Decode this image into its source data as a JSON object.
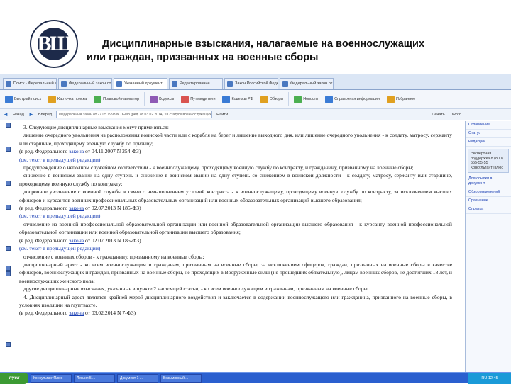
{
  "slide": {
    "title_line1": "Дисциплинарные взыскания, налагаемые на военнослужащих",
    "title_line2": "или граждан, призванных на военные сборы",
    "logo_letters": "ВШ"
  },
  "browser": {
    "tabs": [
      "Поиск - Федеральный закон от 27.05...",
      "Федеральный закон от 27.05.1998 ...",
      "Указанный документ",
      "Редактирование ...",
      "Закон Российской Федерации ...",
      "Федеральный закон от 28.03..."
    ],
    "toolbar": [
      {
        "label": "Быстрый поиск",
        "icon": "search-icon",
        "color": "#3a7bd5"
      },
      {
        "label": "Карточка поиска",
        "icon": "card-icon",
        "color": "#e0a020"
      },
      {
        "label": "Правовой навигатор",
        "icon": "navigator-icon",
        "color": "#4caf50"
      },
      {
        "label": "Кодексы",
        "icon": "book-icon",
        "color": "#8e5ab5"
      },
      {
        "label": "Путеводители",
        "icon": "guide-icon",
        "color": "#d9534f"
      },
      {
        "label": "Кодексы РФ",
        "icon": "codex-icon",
        "color": "#3a7bd5"
      },
      {
        "label": "Обзоры",
        "icon": "review-icon",
        "color": "#e0a020"
      },
      {
        "label": "Новости",
        "icon": "news-icon",
        "color": "#4caf50"
      },
      {
        "label": "Справочная информация",
        "icon": "info-icon",
        "color": "#3a7bd5"
      },
      {
        "label": "Избранное",
        "icon": "star-icon",
        "color": "#e0a020"
      }
    ],
    "nav": {
      "back": "Назад",
      "forward": "Вперед",
      "address": "Федеральный закон от 27.05.1998 N 76-ФЗ (ред. от 03.02.2014) \"О статусе военнослужащих\"",
      "find": "Найти",
      "right_1": "Печать",
      "right_2": "Word"
    }
  },
  "document": {
    "paragraphs": [
      {
        "type": "text",
        "text": "3. Следующие дисциплинарные взыскания могут применяться:"
      },
      {
        "type": "text",
        "text": "лишение очередного увольнения из расположения воинской части или с корабля на берег и лишение выходного дня, или лишение очередного увольнения - к солдату, матросу, сержанту или старшине, проходящему военную службу по призыву;"
      },
      {
        "type": "ed",
        "before": "(в ред. Федерального ",
        "link": "закона",
        "after": " от 04.11.2007 N 254-ФЗ)"
      },
      {
        "type": "prev",
        "text": "(см. текст в предыдущей редакции)"
      },
      {
        "type": "text",
        "text": "предупреждение о неполном служебном соответствии - к военнослужащему, проходящему военную службу по контракту, и гражданину, призванному на военные сборы;"
      },
      {
        "type": "text",
        "text": "снижение в воинском звании на одну ступень и снижение в воинском звании на одну ступень со снижением в воинской должности - к солдату, матросу, сержанту или старшине, проходящему военную службу по контракту;"
      },
      {
        "type": "text",
        "text": "досрочное увольнение с военной службы в связи с невыполнением условий контракта - к военнослужащему, проходящему военную службу по контракту, за исключением высших офицеров и курсантов военных профессиональных образовательных организаций или военных образовательных организаций высшего образования;"
      },
      {
        "type": "ed",
        "before": "(в ред. Федерального ",
        "link": "закона",
        "after": " от 02.07.2013 N 185-ФЗ)"
      },
      {
        "type": "prev",
        "text": "(см. текст в предыдущей редакции)"
      },
      {
        "type": "text",
        "text": "отчисление из военной профессиональной образовательной организации или военной образовательной организации высшего образования - к курсанту военной профессиональной образовательной организации или военной образовательной организации высшего образования;"
      },
      {
        "type": "ed",
        "before": "(в ред. Федерального ",
        "link": "закона",
        "after": " от 02.07.2013 N 185-ФЗ)"
      },
      {
        "type": "prev",
        "text": "(см. текст в предыдущей редакции)"
      },
      {
        "type": "text",
        "text": "отчисление с военных сборов - к гражданину, призванному на военные сборы;"
      },
      {
        "type": "text",
        "text": "дисциплинарный арест - ко всем военнослужащим и гражданам, призванным на военные сборы, за исключением офицеров, граждан, призванных на военные сборы в качестве офицеров, военнослужащих и граждан, призванных на военные сборы, не проходящих в Вооруженные силы (не прошедших обязательную), лицам военных сборов, не достигших 18 лет, и военнослужащих женского пола;"
      },
      {
        "type": "text",
        "text": "другие дисциплинарные взыскания, указанные в пункте 2 настоящей статьи, - ко всем военнослужащим и гражданам, призванным на военные сборы."
      },
      {
        "type": "text",
        "text": "4. Дисциплинарный арест является крайней мерой дисциплинарного воздействия и заключается в содержании военнослужащего или гражданина, призванного на военные сборы, в условиях изоляции на гауптвахте."
      },
      {
        "type": "ed",
        "before": "(в ред. Федерального ",
        "link": "закона",
        "after": " от 03.02.2014 N 7-ФЗ)"
      }
    ]
  },
  "sidepanel": {
    "items": [
      "Оглавление",
      "Статус",
      "Редакции"
    ],
    "box": "Экспертная поддержка 8 (800) 555-55-55 Консультант Плюс",
    "links": [
      "Для ссылки в документ",
      "Обзор изменений",
      "Сравнение",
      "Справка"
    ]
  },
  "taskbar": {
    "start": "пуск",
    "items": [
      "КонсультантПлюс",
      "Лекция 5 ...",
      "Документ 1 ...",
      "Безымянный ..."
    ],
    "tray": "RU 12:45"
  }
}
